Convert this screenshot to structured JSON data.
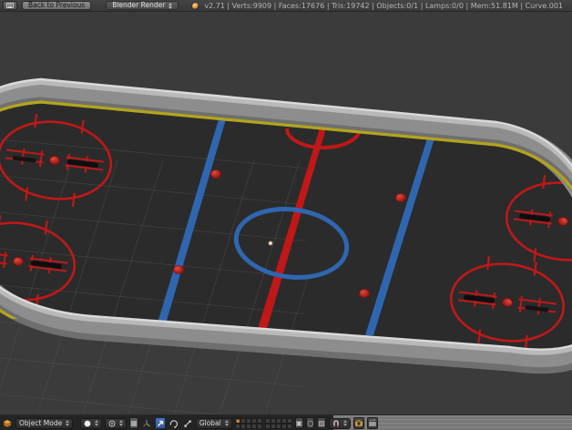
{
  "header": {
    "editor_icon": "info-editor-icon",
    "back_button_label": "Back to Previous",
    "engine_selector_value": "Blender Render",
    "app_icon": "blender-logo",
    "stats_text": "v2.71 | Verts:9909 | Faces:17676 | Tris:19742 | Objects:0/1 | Lamps:0/0 | Mem:51.81M | Curve.001"
  },
  "viewport": {
    "scene": "hockey-rink-3d-model",
    "markings": [
      "center-red-line",
      "referee-crease",
      "center-blue-circle",
      "blue-line-left",
      "blue-line-right",
      "faceoff-circle-upper-left",
      "faceoff-circle-lower-left",
      "faceoff-circle-upper-right",
      "faceoff-circle-lower-right",
      "neutral-faceoff-dots",
      "3d-cursor-dot"
    ]
  },
  "footer": {
    "mode_selector_value": "Object Mode",
    "orientation_selector_value": "Global",
    "active_layer_index": 1,
    "layer_count": 20,
    "icon_glyphs": {
      "scene_lock": "▣",
      "proportional": "○",
      "snap_element": "▨"
    },
    "icons": [
      "viewport-editor-icon",
      "viewport-shading-icon",
      "pivot-center-icon",
      "manipulator-axis-icon",
      "translate-manipulator-icon",
      "rotate-manipulator-icon",
      "scale-manipulator-icon",
      "layers-grid",
      "scene-lock-icon",
      "proportional-edit-icon",
      "snap-element-icon",
      "magnet-snap-icon",
      "render-image-icon",
      "render-animation-icon"
    ]
  },
  "colors": {
    "viewport_bg": "#3b3b3b",
    "ice": "#2b2b2b",
    "rink_red": "#c01818",
    "rink_blue": "#2f66b0",
    "board_yellow": "#b3a41c",
    "header_bg": "#3c3c3c",
    "footer_dark": "#242424",
    "footer_gray": "#7e7e7e",
    "accent_orange": "#e8820c",
    "active_tool_blue": "#3a66a8"
  }
}
